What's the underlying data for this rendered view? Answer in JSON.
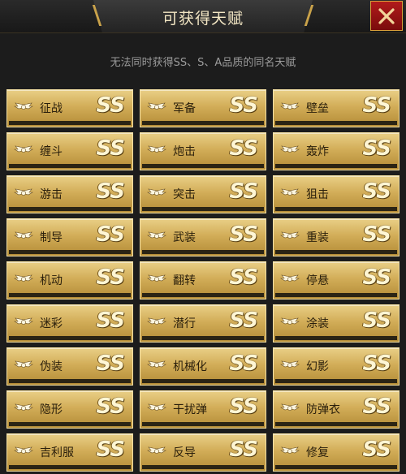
{
  "header": {
    "title": "可获得天赋",
    "close_icon": "close-icon"
  },
  "subtitle": "无法同时获得SS、S、A品质的同名天赋",
  "colors": {
    "gold": "#d2ad58",
    "close_red": "#b11b1b"
  },
  "talents": [
    {
      "name": "征战",
      "grade": "SS"
    },
    {
      "name": "军备",
      "grade": "SS"
    },
    {
      "name": "壁垒",
      "grade": "SS"
    },
    {
      "name": "缠斗",
      "grade": "SS"
    },
    {
      "name": "炮击",
      "grade": "SS"
    },
    {
      "name": "轰炸",
      "grade": "SS"
    },
    {
      "name": "游击",
      "grade": "SS"
    },
    {
      "name": "突击",
      "grade": "SS"
    },
    {
      "name": "狙击",
      "grade": "SS"
    },
    {
      "name": "制导",
      "grade": "SS"
    },
    {
      "name": "武装",
      "grade": "SS"
    },
    {
      "name": "重装",
      "grade": "SS"
    },
    {
      "name": "机动",
      "grade": "SS"
    },
    {
      "name": "翻转",
      "grade": "SS"
    },
    {
      "name": "停悬",
      "grade": "SS"
    },
    {
      "name": "迷彩",
      "grade": "SS"
    },
    {
      "name": "潜行",
      "grade": "SS"
    },
    {
      "name": "涂装",
      "grade": "SS"
    },
    {
      "name": "伪装",
      "grade": "SS"
    },
    {
      "name": "机械化",
      "grade": "SS"
    },
    {
      "name": "幻影",
      "grade": "SS"
    },
    {
      "name": "隐形",
      "grade": "SS"
    },
    {
      "name": "干扰弹",
      "grade": "SS"
    },
    {
      "name": "防弹衣",
      "grade": "SS"
    },
    {
      "name": "吉利服",
      "grade": "SS"
    },
    {
      "name": "反导",
      "grade": "SS"
    },
    {
      "name": "修复",
      "grade": "SS"
    }
  ]
}
